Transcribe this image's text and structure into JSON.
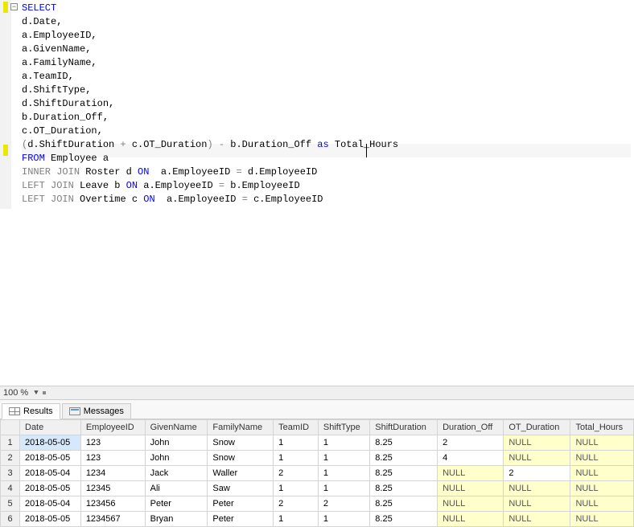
{
  "zoom": "100 %",
  "tabs": {
    "results": "Results",
    "messages": "Messages"
  },
  "sql": {
    "l1": "SELECT",
    "l2": "d.Date,",
    "l3": "a.EmployeeID,",
    "l4": "a.GivenName,",
    "l5": "a.FamilyName,",
    "l6": "a.TeamID,",
    "l7": "d.ShiftType,",
    "l8": "d.ShiftDuration,",
    "l9": "b.Duration_Off,",
    "l10": "c.OT_Duration,",
    "l11a": "(",
    "l11b": "d.ShiftDuration ",
    "l11c": "+",
    "l11d": " c.OT_Duration",
    "l11e": ")",
    "l11f": " - ",
    "l11g": "b.Duration_Off ",
    "l11h": "as",
    "l11i": " Total_Hours",
    "l12a": "FROM",
    "l12b": " Employee a",
    "l13a": "INNER",
    "l13b": " JOIN",
    "l13c": " Roster d ",
    "l13d": "ON",
    "l13e": "  a.EmployeeID ",
    "l13f": "=",
    "l13g": " d.EmployeeID",
    "l14a": "LEFT",
    "l14b": " JOIN",
    "l14c": " Leave b ",
    "l14d": "ON",
    "l14e": " a.EmployeeID ",
    "l14f": "=",
    "l14g": " b.EmployeeID",
    "l15a": "LEFT",
    "l15b": " JOIN",
    "l15c": " Overtime c ",
    "l15d": "ON",
    "l15e": "  a.EmployeeID ",
    "l15f": "=",
    "l15g": " c.EmployeeID"
  },
  "columns": {
    "c1": "Date",
    "c2": "EmployeeID",
    "c3": "GivenName",
    "c4": "FamilyName",
    "c5": "TeamID",
    "c6": "ShiftType",
    "c7": "ShiftDuration",
    "c8": "Duration_Off",
    "c9": "OT_Duration",
    "c10": "Total_Hours"
  },
  "rows": [
    {
      "n": "1",
      "Date": "2018-05-05",
      "EmployeeID": "123",
      "GivenName": "John",
      "FamilyName": "Snow",
      "TeamID": "1",
      "ShiftType": "1",
      "ShiftDuration": "8.25",
      "Duration_Off": "2",
      "OT_Duration": "NULL",
      "Total_Hours": "NULL"
    },
    {
      "n": "2",
      "Date": "2018-05-05",
      "EmployeeID": "123",
      "GivenName": "John",
      "FamilyName": "Snow",
      "TeamID": "1",
      "ShiftType": "1",
      "ShiftDuration": "8.25",
      "Duration_Off": "4",
      "OT_Duration": "NULL",
      "Total_Hours": "NULL"
    },
    {
      "n": "3",
      "Date": "2018-05-04",
      "EmployeeID": "1234",
      "GivenName": "Jack",
      "FamilyName": "Waller",
      "TeamID": "2",
      "ShiftType": "1",
      "ShiftDuration": "8.25",
      "Duration_Off": "NULL",
      "OT_Duration": "2",
      "Total_Hours": "NULL"
    },
    {
      "n": "4",
      "Date": "2018-05-05",
      "EmployeeID": "12345",
      "GivenName": "Ali",
      "FamilyName": "Saw",
      "TeamID": "1",
      "ShiftType": "1",
      "ShiftDuration": "8.25",
      "Duration_Off": "NULL",
      "OT_Duration": "NULL",
      "Total_Hours": "NULL"
    },
    {
      "n": "5",
      "Date": "2018-05-04",
      "EmployeeID": "123456",
      "GivenName": "Peter",
      "FamilyName": "Peter",
      "TeamID": "2",
      "ShiftType": "2",
      "ShiftDuration": "8.25",
      "Duration_Off": "NULL",
      "OT_Duration": "NULL",
      "Total_Hours": "NULL"
    },
    {
      "n": "6",
      "Date": "2018-05-05",
      "EmployeeID": "1234567",
      "GivenName": "Bryan",
      "FamilyName": "Peter",
      "TeamID": "1",
      "ShiftType": "1",
      "ShiftDuration": "8.25",
      "Duration_Off": "NULL",
      "OT_Duration": "NULL",
      "Total_Hours": "NULL"
    }
  ]
}
